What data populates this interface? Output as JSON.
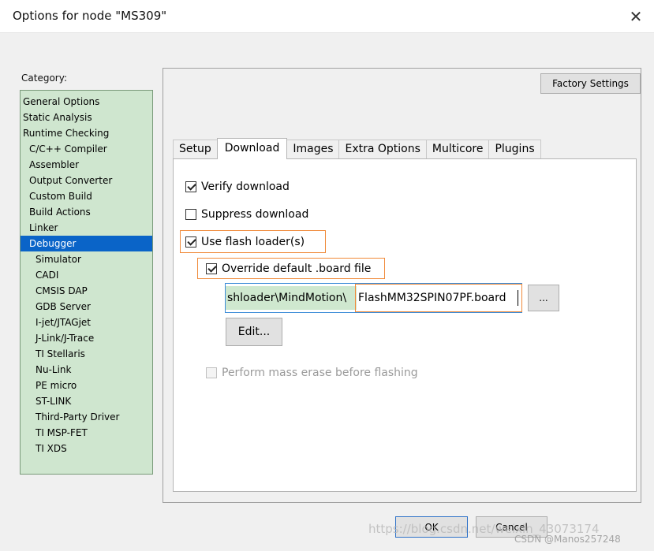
{
  "window": {
    "title": "Options for node \"MS309\"",
    "close_glyph": "✕"
  },
  "category": {
    "label": "Category:",
    "items": [
      {
        "label": "General Options",
        "level": 0
      },
      {
        "label": "Static Analysis",
        "level": 0
      },
      {
        "label": "Runtime Checking",
        "level": 0
      },
      {
        "label": "C/C++ Compiler",
        "level": 1
      },
      {
        "label": "Assembler",
        "level": 1
      },
      {
        "label": "Output Converter",
        "level": 1
      },
      {
        "label": "Custom Build",
        "level": 1
      },
      {
        "label": "Build Actions",
        "level": 1
      },
      {
        "label": "Linker",
        "level": 1
      },
      {
        "label": "Debugger",
        "level": 1,
        "selected": true
      },
      {
        "label": "Simulator",
        "level": 2
      },
      {
        "label": "CADI",
        "level": 2
      },
      {
        "label": "CMSIS DAP",
        "level": 2
      },
      {
        "label": "GDB Server",
        "level": 2
      },
      {
        "label": "I-jet/JTAGjet",
        "level": 2
      },
      {
        "label": "J-Link/J-Trace",
        "level": 2
      },
      {
        "label": "TI Stellaris",
        "level": 2
      },
      {
        "label": "Nu-Link",
        "level": 2
      },
      {
        "label": "PE micro",
        "level": 2
      },
      {
        "label": "ST-LINK",
        "level": 2
      },
      {
        "label": "Third-Party Driver",
        "level": 2
      },
      {
        "label": "TI MSP-FET",
        "level": 2
      },
      {
        "label": "TI XDS",
        "level": 2
      }
    ]
  },
  "factory_settings_label": "Factory Settings",
  "tabs": [
    {
      "label": "Setup",
      "active": false
    },
    {
      "label": "Download",
      "active": true
    },
    {
      "label": "Images",
      "active": false
    },
    {
      "label": "Extra Options",
      "active": false
    },
    {
      "label": "Multicore",
      "active": false
    },
    {
      "label": "Plugins",
      "active": false
    }
  ],
  "download": {
    "verify_label": "Verify download",
    "verify_checked": true,
    "suppress_label": "Suppress download",
    "suppress_checked": false,
    "flash_loader_label": "Use flash loader(s)",
    "flash_loader_checked": true,
    "override_label": "Override default .board file",
    "override_checked": true,
    "board_path_selected": "shloader\\MindMotion\\",
    "board_path_rest": "FlashMM32SPIN07PF.board",
    "browse_label": "...",
    "edit_label": "Edit...",
    "mass_erase_label": "Perform mass erase before flashing",
    "mass_erase_checked": false
  },
  "footer": {
    "ok_label": "OK",
    "cancel_label": "Cancel",
    "watermark_url": "https://blog.csdn.net/weixin_43073174",
    "watermark_credit": "CSDN @Manos257248"
  },
  "colors": {
    "category_bg": "#cfe6cf",
    "selection": "#0a64c8",
    "highlight_box": "#f08a3a",
    "input_focus": "#3c8cd8"
  }
}
